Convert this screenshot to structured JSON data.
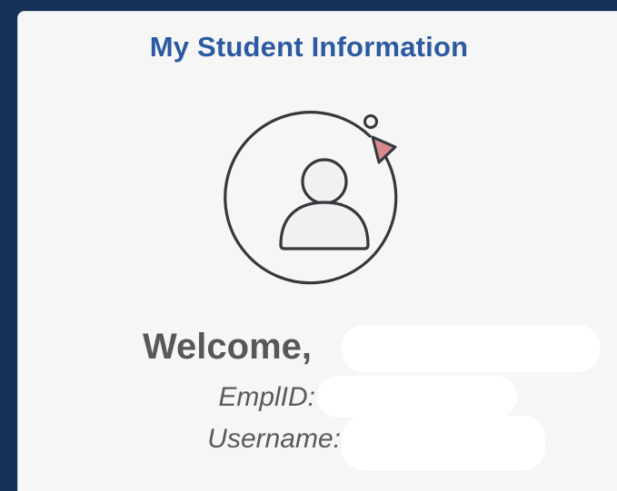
{
  "tile": {
    "title": "My Student Information"
  },
  "profile": {
    "welcome_label": "Welcome,",
    "emplid_label": "EmplID:",
    "username_label": "Username:"
  },
  "icons": {
    "profile_icon": "user-refresh-icon"
  },
  "colors": {
    "background": "#163156",
    "tile": "#f6f6f7",
    "title": "#2b5aa0",
    "text": "#585858",
    "arrow": "#d98a8f"
  }
}
